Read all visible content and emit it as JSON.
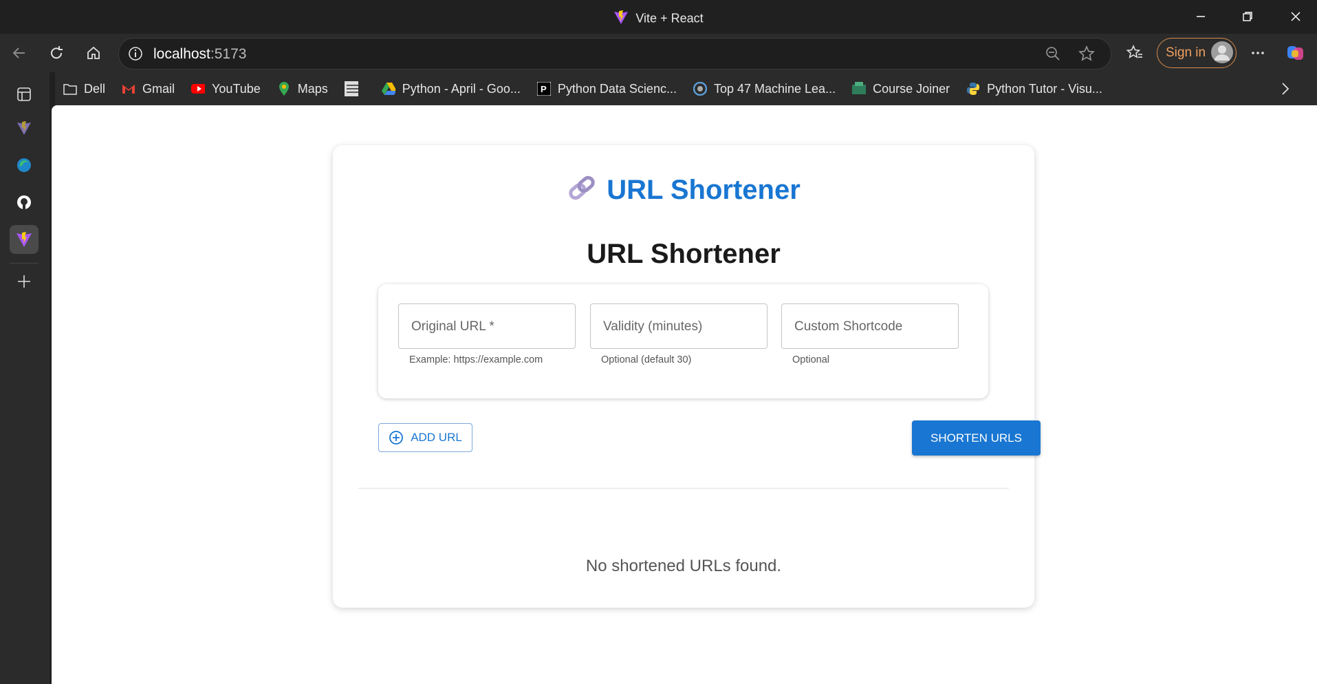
{
  "browser": {
    "window_title": "Vite + React",
    "address": {
      "host": "localhost",
      "port": ":5173"
    },
    "sign_in_label": "Sign in",
    "bookmarks": [
      {
        "label": "Dell",
        "icon": "folder-icon"
      },
      {
        "label": "Gmail",
        "icon": "gmail-icon"
      },
      {
        "label": "YouTube",
        "icon": "youtube-icon"
      },
      {
        "label": "Maps",
        "icon": "maps-icon"
      },
      {
        "label": "",
        "icon": "site-icon"
      },
      {
        "label": "Python - April - Goo...",
        "icon": "drive-icon"
      },
      {
        "label": "Python Data Scienc...",
        "icon": "site-icon"
      },
      {
        "label": "Top 47 Machine Lea...",
        "icon": "site-icon"
      },
      {
        "label": "Course Joiner",
        "icon": "site-icon"
      },
      {
        "label": "Python Tutor - Visu...",
        "icon": "python-icon"
      }
    ]
  },
  "app": {
    "brand_title": "URL Shortener",
    "heading": "URL Shortener",
    "fields": {
      "original_url": {
        "placeholder": "Original URL *",
        "helper": "Example: https://example.com"
      },
      "validity": {
        "placeholder": "Validity (minutes)",
        "helper": "Optional (default 30)"
      },
      "shortcode": {
        "placeholder": "Custom Shortcode",
        "helper": "Optional"
      }
    },
    "add_url_label": "ADD URL",
    "shorten_label": "SHORTEN URLS",
    "empty_message": "No shortened URLs found.",
    "accent_color": "#1976d2"
  }
}
